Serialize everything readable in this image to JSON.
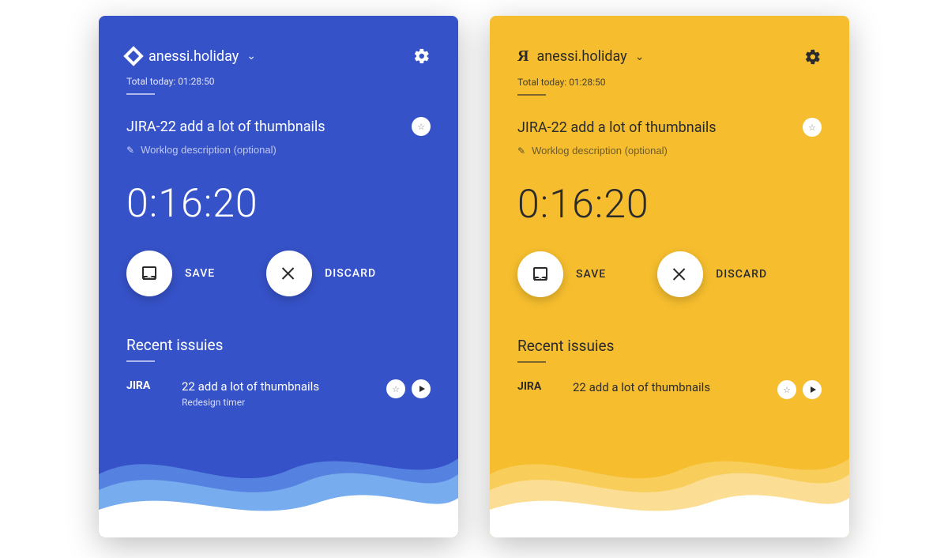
{
  "cards": [
    {
      "theme": "blue",
      "bg": "#3652C8",
      "wave1": "#5E8FE7",
      "wave2": "#7FB7F3",
      "wave3": "#FFFFFF",
      "logo_glyph": "",
      "username": "anessi.holiday",
      "total_label": "Total today: 01:28:50",
      "task_title": "JIRA-22 add a lot of thumbnails",
      "desc_placeholder": "Worklog description (optional)",
      "timer": "0:16:20",
      "save_label": "SAVE",
      "discard_label": "DISCARD",
      "recent_title": "Recent issuies",
      "recent": [
        {
          "key": "JIRA",
          "summary": "22 add a lot of thumbnails",
          "sub": "Redesign timer"
        }
      ]
    },
    {
      "theme": "yellow",
      "bg": "#F6BE2E",
      "wave1": "#F8CE5F",
      "wave2": "#FBE09A",
      "wave3": "#FFFFFF",
      "logo_glyph": "Я",
      "username": "anessi.holiday",
      "total_label": "Total today: 01:28:50",
      "task_title": "JIRA-22 add a lot of thumbnails",
      "desc_placeholder": "Worklog description (optional)",
      "timer": "0:16:20",
      "save_label": "SAVE",
      "discard_label": "DISCARD",
      "recent_title": "Recent issuies",
      "recent": [
        {
          "key": "JIRA",
          "summary": "22 add a lot of thumbnails",
          "sub": ""
        }
      ]
    }
  ]
}
